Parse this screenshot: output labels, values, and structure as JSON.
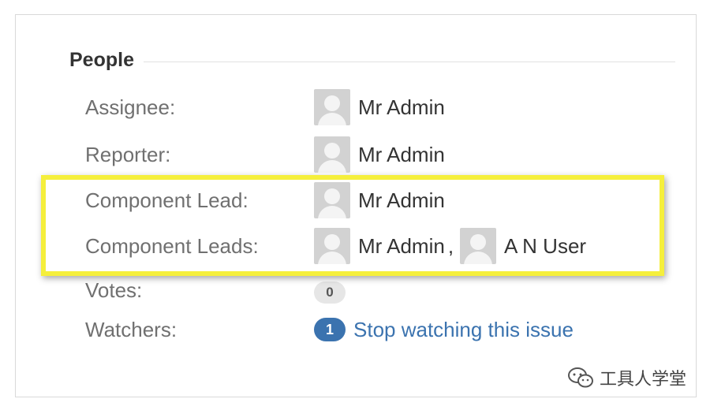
{
  "section": {
    "title": "People"
  },
  "fields": {
    "assignee": {
      "label": "Assignee:",
      "user": "Mr Admin"
    },
    "reporter": {
      "label": "Reporter:",
      "user": "Mr Admin"
    },
    "component_lead": {
      "label": "Component Lead:",
      "user": "Mr Admin"
    },
    "component_leads": {
      "label": "Component Leads:",
      "users": [
        "Mr Admin",
        "A N User"
      ],
      "separator": ","
    },
    "votes": {
      "label": "Votes:",
      "count": "0"
    },
    "watchers": {
      "label": "Watchers:",
      "count": "1",
      "action_link": "Stop watching this issue"
    }
  },
  "annotation": {
    "highlight_color": "#f5ef3c"
  },
  "watermark": {
    "icon": "wechat-icon",
    "text": "工具人学堂"
  },
  "colors": {
    "label": "#707070",
    "value": "#333333",
    "link": "#3b73af",
    "avatar": "#d2d2d2"
  }
}
